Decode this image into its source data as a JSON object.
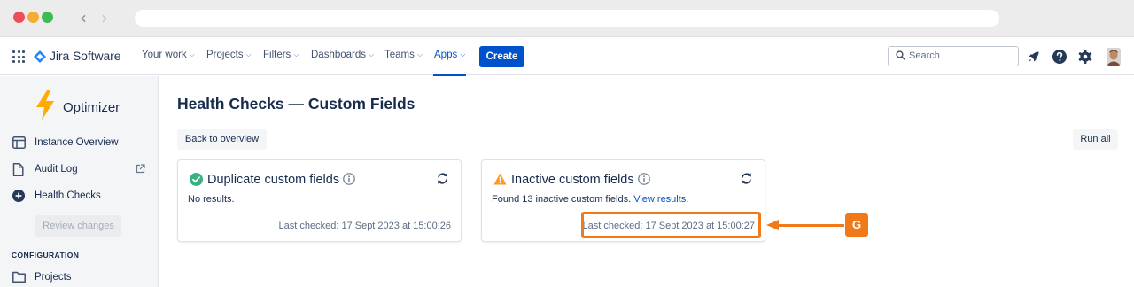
{
  "browser": {
    "back_glyph": "‹",
    "forward_glyph": "›"
  },
  "topnav": {
    "product_name": "Jira Software",
    "menus": [
      {
        "label": "Your work"
      },
      {
        "label": "Projects"
      },
      {
        "label": "Filters"
      },
      {
        "label": "Dashboards"
      },
      {
        "label": "Teams"
      },
      {
        "label": "Apps"
      }
    ],
    "active_menu": "Apps",
    "create_label": "Create",
    "search_placeholder": "Search",
    "icons": [
      "notifications-rocket-icon",
      "help-icon",
      "settings-gear-icon"
    ],
    "accent_color": "#0052cc"
  },
  "sidebar": {
    "app_name": "Optimizer",
    "items": [
      {
        "label": "Instance Overview",
        "icon": "overview-icon"
      },
      {
        "label": "Audit Log",
        "icon": "document-icon",
        "external": true
      },
      {
        "label": "Health Checks",
        "icon": "plus-circle-icon"
      }
    ],
    "review_label": "Review changes",
    "section_label": "CONFIGURATION",
    "config_items": [
      {
        "label": "Projects",
        "icon": "folder-icon"
      }
    ]
  },
  "main": {
    "title": "Health Checks — Custom Fields",
    "back_label": "Back to overview",
    "run_all_label": "Run all",
    "cards": [
      {
        "title": "Duplicate custom fields",
        "status": "success",
        "status_color": "#36b37e",
        "description": "No results.",
        "last_checked": "Last checked: 17 Sept 2023 at 15:00:26"
      },
      {
        "title": "Inactive custom fields",
        "status": "warning",
        "status_color": "#ff991f",
        "description": "Found 13 inactive custom fields.",
        "link_text": "View results.",
        "last_checked": "Last checked: 17 Sept 2023 at 15:00:27"
      }
    ]
  },
  "annotation": {
    "badge_label": "G",
    "color": "#f07a1a"
  }
}
